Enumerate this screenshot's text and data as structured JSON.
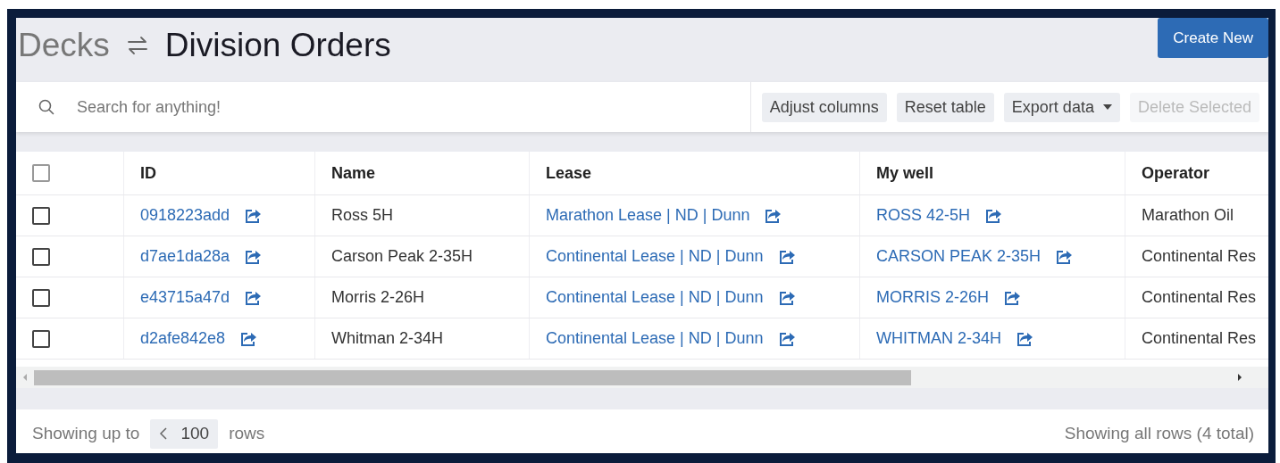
{
  "breadcrumb": {
    "parent": "Decks",
    "title": "Division Orders"
  },
  "create_button": "Create New",
  "search": {
    "placeholder": "Search for anything!"
  },
  "toolbar": [
    {
      "label": "Adjust columns",
      "disabled": false,
      "dropdown": false
    },
    {
      "label": "Reset table",
      "disabled": false,
      "dropdown": false
    },
    {
      "label": "Export data",
      "disabled": false,
      "dropdown": true
    },
    {
      "label": "Delete Selected",
      "disabled": true,
      "dropdown": false
    }
  ],
  "table": {
    "select_all_checked": false,
    "columns": [
      "ID",
      "Name",
      "Lease",
      "My well",
      "Operator"
    ],
    "rows": [
      {
        "checked": false,
        "id": "0918223add",
        "name": "Ross 5H",
        "lease": "Marathon Lease | ND | Dunn",
        "well": "ROSS 42-5H",
        "operator": "Marathon Oil"
      },
      {
        "checked": false,
        "id": "d7ae1da28a",
        "name": "Carson Peak 2-35H",
        "lease": "Continental Lease | ND | Dunn",
        "well": "CARSON PEAK 2-35H",
        "operator": "Continental Res"
      },
      {
        "checked": false,
        "id": "e43715a47d",
        "name": "Morris 2-26H",
        "lease": "Continental Lease | ND | Dunn",
        "well": "MORRIS 2-26H",
        "operator": "Continental Res"
      },
      {
        "checked": false,
        "id": "d2afe842e8",
        "name": "Whitman 2-34H",
        "lease": "Continental Lease | ND | Dunn",
        "well": "WHITMAN 2-34H",
        "operator": "Continental Res"
      }
    ]
  },
  "footer": {
    "prefix": "Showing up to",
    "page_size": "100",
    "suffix": "rows",
    "summary": "Showing all rows (4 total)"
  }
}
